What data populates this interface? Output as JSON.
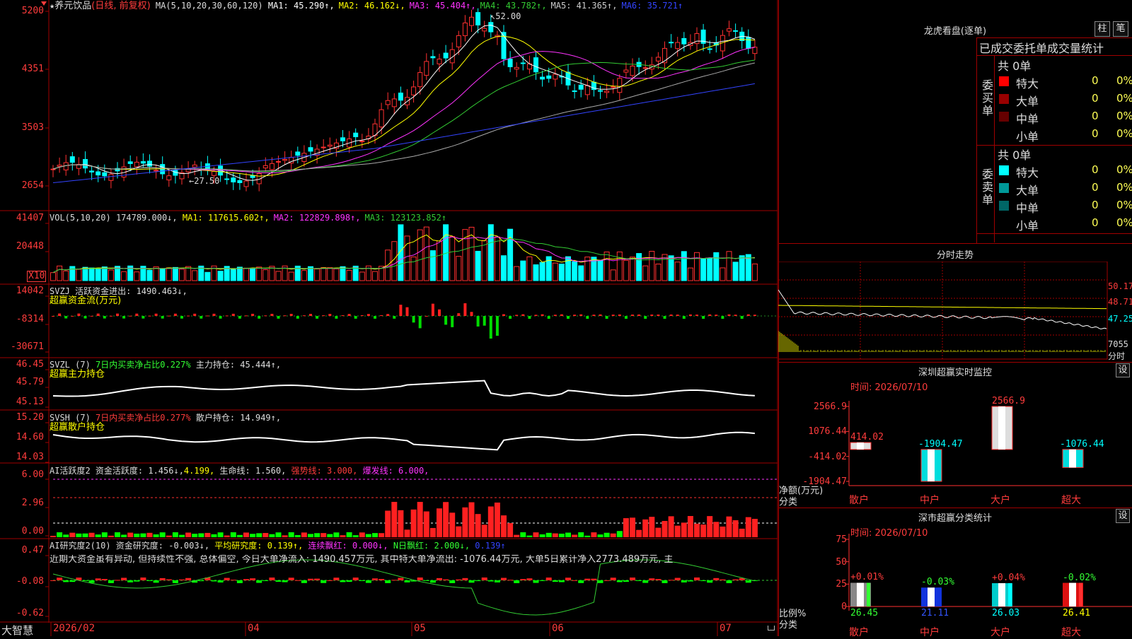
{
  "stock": {
    "star": "★",
    "name": "养元饮品",
    "mode": "(日线, 前复权)",
    "ma_header": "MA(5,10,20,30,60,120)",
    "ma_values": [
      {
        "label": "MA1: 45.290↑,",
        "color": "#ffffff"
      },
      {
        "label": "MA2: 46.162↓,",
        "color": "#ffff00"
      },
      {
        "label": "MA3: 45.404↑,",
        "color": "#ff33ff"
      },
      {
        "label": "MA4: 43.782↑,",
        "color": "#33cc33"
      },
      {
        "label": "MA5: 41.365↑,",
        "color": "#cccccc"
      },
      {
        "label": "MA6: 35.721↑",
        "color": "#3344ff"
      }
    ],
    "high_label": "52.00",
    "low_label": "27.50",
    "price_ticks": [
      "5200",
      "4351",
      "3503",
      "2654"
    ]
  },
  "volume": {
    "header_name": "VOL(5,10,20)",
    "header_value": "174789.000↓,",
    "ma_values": [
      {
        "label": "MA1: 117615.602↑,",
        "color": "#ffff00"
      },
      {
        "label": "MA2: 122829.898↑,",
        "color": "#ff33ff"
      },
      {
        "label": "MA3: 123123.852↑",
        "color": "#33cc33"
      }
    ],
    "ticks": [
      "41407",
      "20448"
    ],
    "unit": "X10"
  },
  "svzj": {
    "line1": "SVZJ  活跃资金进出: 1490.463↓,",
    "line2": "超赢资金流(万元)",
    "ticks": [
      "14042",
      "-8314",
      "-30671"
    ]
  },
  "svzl": {
    "prefix": "SVZL (7)",
    "ratio": "7日内买卖净占比0.227%",
    "hold": "主力持仓: 45.444↑,",
    "line2": "超赢主力持仓",
    "ticks": [
      "46.45",
      "45.79",
      "45.13"
    ]
  },
  "svsh": {
    "prefix": "SVSH (7)",
    "ratio": "7日内买卖净占比0.277%",
    "hold": "散户持仓: 14.949↑,",
    "line2": "超赢散户持仓",
    "ticks": [
      "15.20",
      "14.60",
      "14.03"
    ]
  },
  "ai1": {
    "prefix": "AI活跃度2 资金活跃度: 1.456↓,",
    "v2": "4.199,",
    "life": "生命线: 1.560,",
    "strong": "强势线: 3.000,",
    "burst": "爆发线: 6.000,",
    "ticks": [
      "6.00",
      "2.96",
      "0.00"
    ]
  },
  "ai2": {
    "prefix": "AI研究度2(10) 资金研究度: -0.003↓,",
    "avg": "平均研究度: 0.139↑,",
    "cont": "连续飘红: 0.000↓,",
    "nday": "N日飘红: 2.000↓,",
    "last": "0.139↑",
    "comment": "近期大资金虽有异动, 但持续性不强, 总体偏空, 今日大单净流入: 1490.457万元, 其中特大单净流出: -1076.44万元, 大单5日累计净入2773.489万元, 主",
    "ticks": [
      "0.47",
      "-0.08",
      "-0.62"
    ]
  },
  "xaxis": {
    "brand": "大智慧",
    "labels": [
      "2026/02",
      "04",
      "05",
      "06",
      "07"
    ]
  },
  "dragon": {
    "title": "龙虎看盘(逐单)",
    "btn_bar": "柱",
    "btn_pen": "笔",
    "tabs": "已成交委托单成交量统计",
    "buy": {
      "side_label": "委买单",
      "total": "共 0单",
      "rows": [
        {
          "name": "特大",
          "count": "0",
          "pct": "0%",
          "color": "#ff0000"
        },
        {
          "name": "大单",
          "count": "0",
          "pct": "0%",
          "color": "#990000"
        },
        {
          "name": "中单",
          "count": "0",
          "pct": "0%",
          "color": "#660000"
        },
        {
          "name": "小单",
          "count": "0",
          "pct": "0%",
          "color": "#000000"
        }
      ]
    },
    "sell": {
      "side_label": "委卖单",
      "total": "共 0单",
      "rows": [
        {
          "name": "特大",
          "count": "0",
          "pct": "0%",
          "color": "#00ffff"
        },
        {
          "name": "大单",
          "count": "0",
          "pct": "0%",
          "color": "#009999"
        },
        {
          "name": "中单",
          "count": "0",
          "pct": "0%",
          "color": "#006666"
        },
        {
          "name": "小单",
          "count": "0",
          "pct": "0%",
          "color": "#000000"
        }
      ]
    }
  },
  "intraday": {
    "title": "分时走势",
    "ticks": [
      "50.17",
      "48.71",
      "47.25"
    ],
    "vol_tick": "7055",
    "vol_unit": "分时"
  },
  "monitor": {
    "title": "深圳超赢实时监控",
    "btn": "设",
    "time": "时间: 2026/07/10",
    "ticks": [
      "2566.9",
      "1076.44",
      "-414.02",
      "-1904.47"
    ],
    "ylabel": "净额(万元)",
    "xlabel": "分类",
    "bars": [
      {
        "cat": "散户",
        "label": "414.02",
        "value": 414.02
      },
      {
        "cat": "中户",
        "label": "-1904.47",
        "value": -1904.47
      },
      {
        "cat": "大户",
        "label": "2566.9",
        "value": 2566.9
      },
      {
        "cat": "超大",
        "label": "-1076.44",
        "value": -1076.44
      }
    ]
  },
  "classify": {
    "title": "深市超赢分类统计",
    "btn": "设",
    "time": "时间: 2026/07/10",
    "ticks": [
      "75",
      "50",
      "25",
      "0"
    ],
    "ylabel": "比例%",
    "xlabel": "分类",
    "bars": [
      {
        "cat": "散户",
        "top": "+0.01%",
        "bottom": "26.45",
        "value": 26.45
      },
      {
        "cat": "中户",
        "top": "-0.03%",
        "bottom": "21.11",
        "value": 21.11
      },
      {
        "cat": "大户",
        "top": "+0.04%",
        "bottom": "26.03",
        "value": 26.03
      },
      {
        "cat": "超大",
        "top": "-0.02%",
        "bottom": "26.41",
        "value": 26.41
      }
    ]
  }
}
